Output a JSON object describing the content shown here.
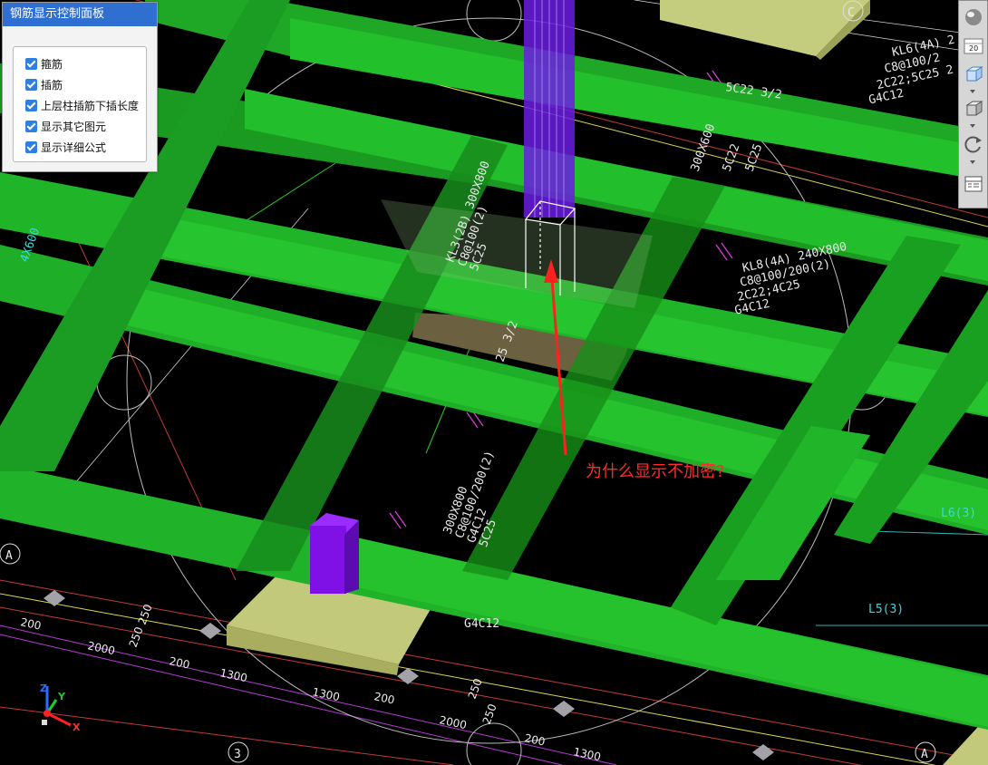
{
  "panel": {
    "title": "钢筋显示控制面板",
    "options": [
      {
        "label": "箍筋",
        "checked": true
      },
      {
        "label": "插筋",
        "checked": true
      },
      {
        "label": "上层柱插筋下插长度",
        "checked": true
      },
      {
        "label": "显示其它图元",
        "checked": true
      },
      {
        "label": "显示详细公式",
        "checked": true
      }
    ]
  },
  "toolbar": {
    "icons": [
      "render-sphere-icon",
      "floor-20-icon",
      "cube-view-icon",
      "box-view-icon",
      "rotate-icon",
      "grid-settings-icon"
    ],
    "floor_label": "20"
  },
  "annotation": "为什么显示不加密?",
  "grid_axes": {
    "top": "C",
    "left": "A",
    "bottom": "3",
    "bottom_right": "A"
  },
  "beam_labels": {
    "kl6": [
      "KL6(4A) 2",
      "C8@100/2",
      "2C22;5C25 2",
      "G4C12"
    ],
    "kl8": [
      "KL8(4A) 240X800",
      "C8@100/200(2)",
      "2C22;4C25",
      "G4C12"
    ],
    "kl3": [
      "KL3(2B) 300X800",
      "C8@100(2)",
      "5C25"
    ],
    "mid": [
      "300X800",
      "C8@100/200(2)",
      "G4C12",
      "5C25"
    ],
    "misc": [
      "5C22 3/2",
      "300X600",
      "5C22",
      "5C25",
      "L6(3)",
      "L5(3)",
      "G4C12",
      "4X600",
      "25 3/2"
    ]
  },
  "dimensions": [
    "200",
    "250",
    "2000",
    "250",
    "200",
    "1300",
    "1300",
    "200",
    "250",
    "2000",
    "250",
    "200",
    "1300"
  ],
  "axis_indicator": {
    "x": "X",
    "y": "Y",
    "z": "Z"
  },
  "colors": {
    "beam": "#22b82a",
    "beam_side": "#178c1c",
    "beam_dark": "#0f6a14",
    "column": "#7f11e6",
    "footing": "#b5bf6a",
    "annotation": "#ff2b2b",
    "panel_title": "#2f6fd1"
  }
}
